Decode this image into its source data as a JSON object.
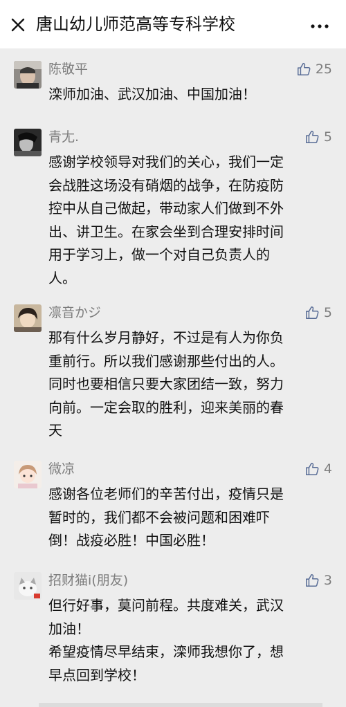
{
  "header": {
    "title": "唐山幼儿师范高等专科学校"
  },
  "comments": [
    {
      "name": "陈敬平",
      "likes": "25",
      "lines": [
        "滦师加油、武汉加油、中国加油！"
      ]
    },
    {
      "name": "青尢.",
      "likes": "5",
      "lines": [
        "感谢学校领导对我们的关心，我们一定",
        "会战胜这场没有硝烟的战争，在防疫防",
        "控中从自己做起，带动家人们做到不外",
        "出、讲卫生。在家会坐到合理安排时间",
        "用于学习上，做一个对自己负责人的",
        "人。"
      ]
    },
    {
      "name": "凛音かジ",
      "likes": "5",
      "lines": [
        "那有什么岁月静好，不过是有人为你负",
        "重前行。所以我们感谢那些付出的人。",
        "同时也要相信只要大家团结一致，努力",
        "向前。一定会取的胜利，迎来美丽的春",
        "天"
      ]
    },
    {
      "name": "微凉",
      "likes": "4",
      "lines": [
        "感谢各位老师们的辛苦付出，疫情只是",
        "暂时的，我们都不会被问题和困难吓",
        "倒！战疫必胜！中国必胜！"
      ]
    },
    {
      "name": "招财猫i(朋友)",
      "likes": "3",
      "lines": [
        "但行好事，莫问前程。共度难关，武汉",
        "加油！",
        "希望疫情尽早结束，滦师我想你了，想",
        "早点回到学校！"
      ]
    }
  ]
}
